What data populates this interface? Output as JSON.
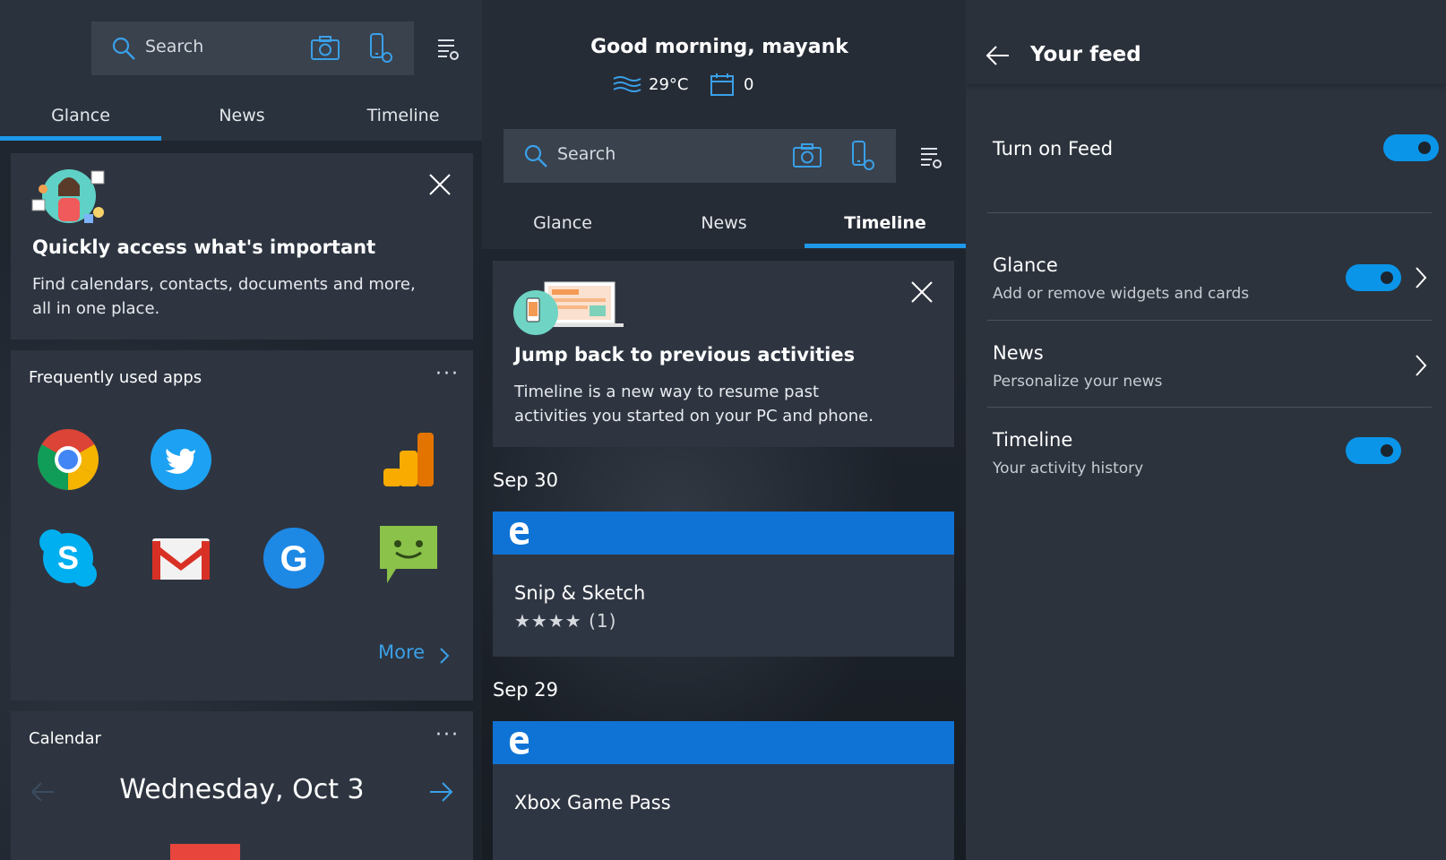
{
  "left_panel": {
    "search": {
      "placeholder": "Search",
      "icons": [
        "search-icon",
        "camera-icon",
        "phone-mic-icon"
      ]
    },
    "settings_icon": "settings-list-icon",
    "tabs": [
      {
        "label": "Glance",
        "active": true
      },
      {
        "label": "News",
        "active": false
      },
      {
        "label": "Timeline",
        "active": false
      }
    ],
    "intro_card": {
      "title": "Quickly access what's important",
      "body": "Find calendars, contacts, documents and more, all in one place.",
      "close_icon": "close-icon",
      "illustration": "person-illustration"
    },
    "frequent_apps": {
      "title": "Frequently used apps",
      "menu": "···",
      "apps": [
        "chrome",
        "twitter",
        "google-analytics",
        "skype",
        "gmail",
        "google",
        "messages"
      ],
      "more_label": "More"
    },
    "calendar": {
      "title": "Calendar",
      "menu": "···",
      "date": "Wednesday, Oct 3"
    }
  },
  "middle_panel": {
    "greeting": "Good morning, mayank",
    "weather": {
      "temperature": "29°C",
      "calendar_count": "0"
    },
    "search": {
      "placeholder": "Search"
    },
    "tabs": [
      {
        "label": "Glance",
        "active": false
      },
      {
        "label": "News",
        "active": false
      },
      {
        "label": "Timeline",
        "active": true
      }
    ],
    "intro_card": {
      "title": "Jump back to previous activities",
      "body": "Timeline is a new way to resume past activities you started on your PC and phone."
    },
    "groups": [
      {
        "date": "Sep 30",
        "items": [
          {
            "title": "Snip & Sketch",
            "rating": "★★★★ (1)"
          }
        ]
      },
      {
        "date": "Sep 29",
        "items": [
          {
            "title": "Xbox Game Pass"
          }
        ]
      }
    ]
  },
  "right_panel": {
    "title": "Your feed",
    "rows": [
      {
        "title": "Turn on Feed",
        "toggle": true,
        "chevron": false
      },
      {
        "title": "Glance",
        "subtitle": "Add or remove widgets and cards",
        "toggle": true,
        "chevron": true
      },
      {
        "title": "News",
        "subtitle": "Personalize your news",
        "toggle": false,
        "chevron": true
      },
      {
        "title": "Timeline",
        "subtitle": "Your activity history",
        "toggle": true,
        "chevron": false
      }
    ]
  },
  "colors": {
    "accent": "#1e98e8",
    "toggle_on": "#0a95e8",
    "timeline_bar": "#0f73d6",
    "card_bg": "#2e3541"
  }
}
